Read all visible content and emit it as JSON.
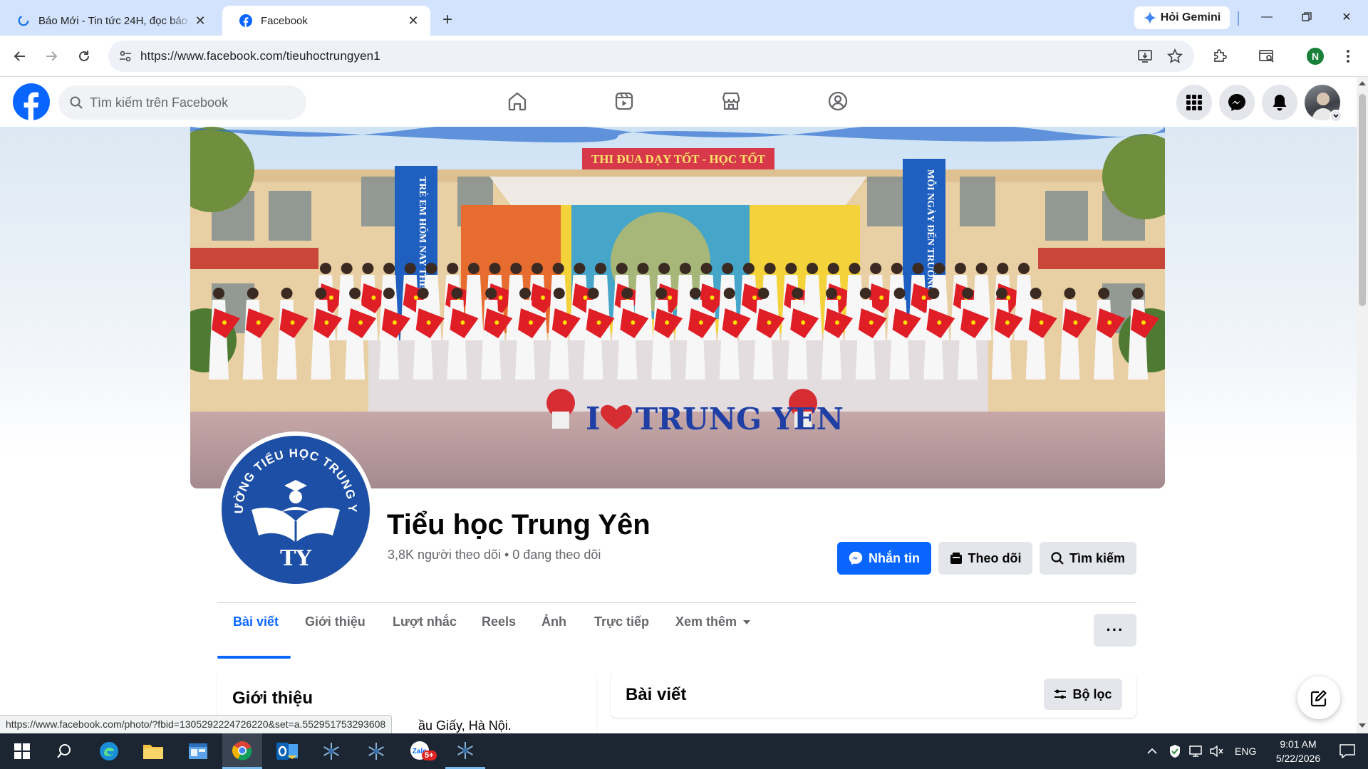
{
  "browser": {
    "tabs": [
      {
        "title": "Báo Mới - Tin tức 24H, đọc báo",
        "active": false
      },
      {
        "title": "Facebook",
        "active": true
      }
    ],
    "gemini_label": "Hỏi Gemini",
    "url": "https://www.facebook.com/tieuhoctrungyen1",
    "profile_initial": "N",
    "status_url": "https://www.facebook.com/photo/?fbid=1305292224726220&set=a.552951753293608"
  },
  "facebook": {
    "search_placeholder": "Tìm kiếm trên Facebook",
    "colors": {
      "brand": "#0866ff",
      "text": "#050505",
      "secondary_text": "#65676b"
    }
  },
  "cover": {
    "banner_top": "THI ĐUA DẠY TỐT - HỌC TỐT",
    "banner_left": "TRẺ EM HÔM NAY THẾ GIỚI NGÀY MAI",
    "banner_right": "MỖI NGÀY ĐẾN TRƯỜNG LÀ MỘT NGÀY VUI",
    "sign_text_1": "I",
    "sign_text_2": "TRUNG YEN"
  },
  "profile": {
    "logo_ring_text": "TRƯỜNG TIỂU HỌC TRUNG YÊN",
    "logo_initials": "TY",
    "name": "Tiểu học Trung Yên",
    "stats": "3,8K người theo dõi • 0 đang theo dõi",
    "buttons": {
      "message": "Nhắn tin",
      "follow": "Theo dõi",
      "search": "Tìm kiếm"
    },
    "tabs": [
      "Bài viết",
      "Giới thiệu",
      "Lượt nhắc",
      "Reels",
      "Ảnh",
      "Trực tiếp",
      "Xem thêm"
    ],
    "more_label": "···"
  },
  "intro": {
    "title": "Giới thiệu",
    "address_partial": "ầu Giấy, Hà Nội."
  },
  "posts": {
    "title": "Bài viết",
    "filter_label": "Bộ lọc"
  },
  "taskbar": {
    "lang": "ENG",
    "time": "9:01 AM",
    "date": "5/22/2026",
    "zalo_badge": "5+"
  }
}
